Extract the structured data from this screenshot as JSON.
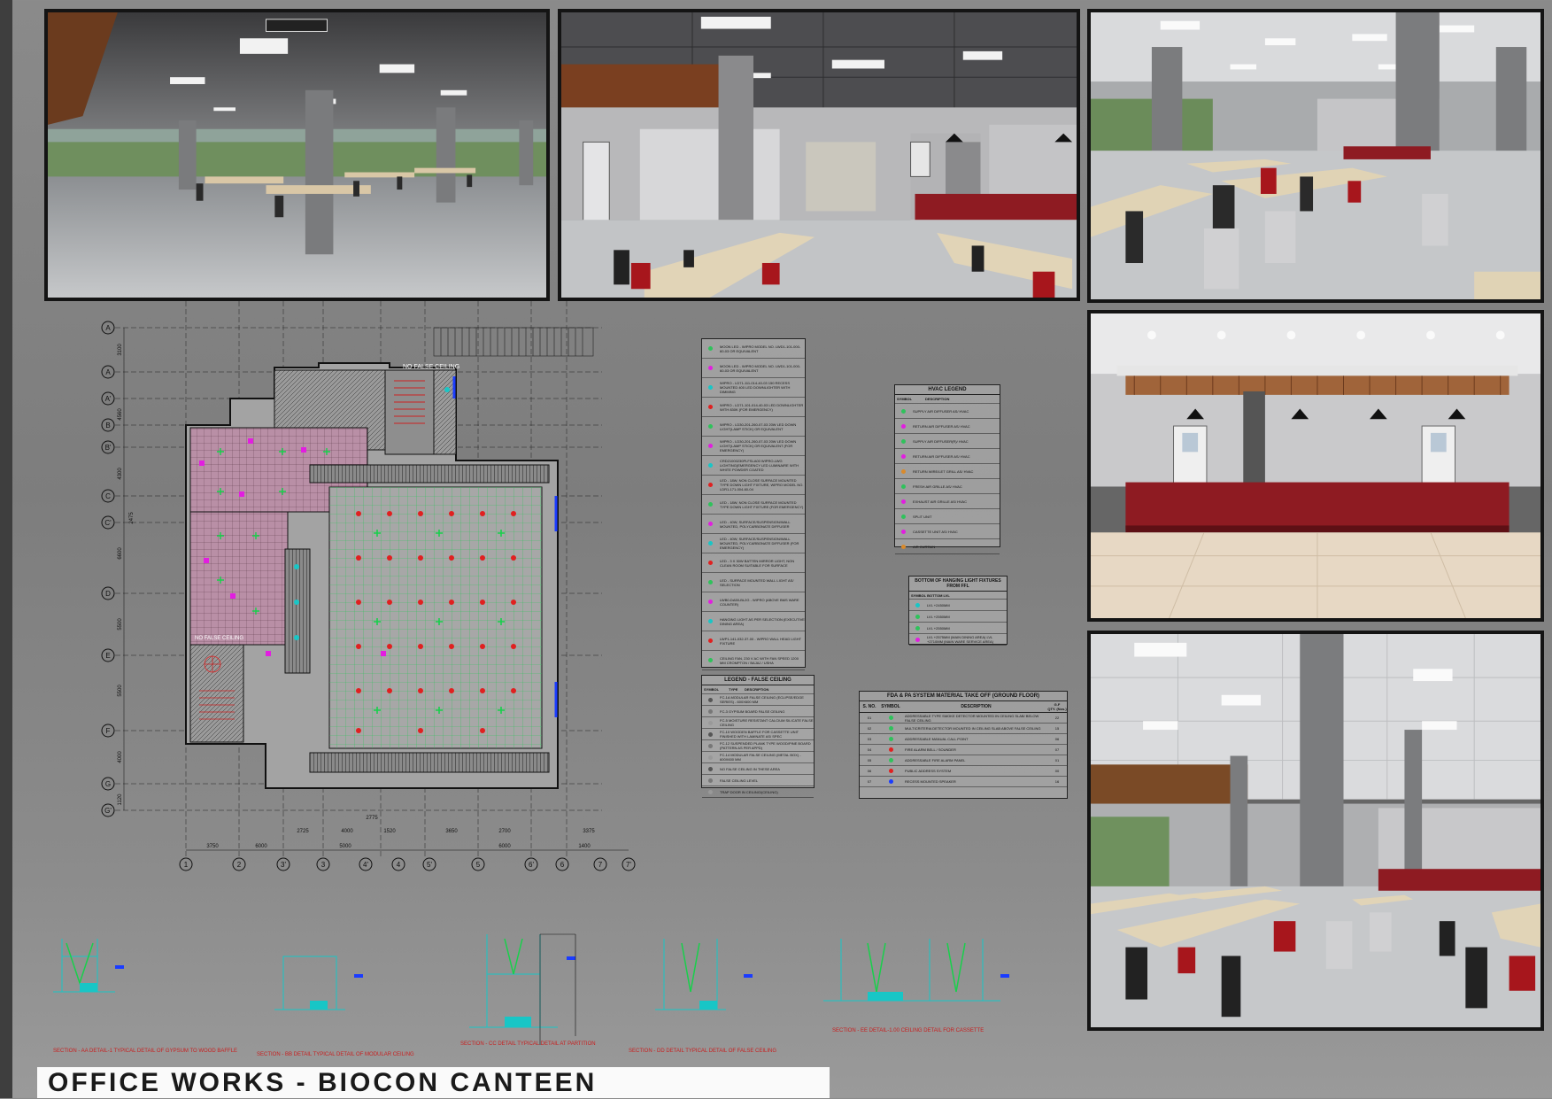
{
  "title": "OFFICE WORKS - BIOCON CANTEEN",
  "renders": [
    {
      "name": "render-dining-hall-wide"
    },
    {
      "name": "render-dining-to-servery"
    },
    {
      "name": "render-dining-tables"
    },
    {
      "name": "render-service-counter"
    },
    {
      "name": "render-dining-columns"
    }
  ],
  "plan": {
    "grid_rows": [
      "A",
      "A",
      "A'",
      "B",
      "B'",
      "C",
      "C'",
      "D",
      "E",
      "F",
      "G",
      "G'"
    ],
    "grid_cols": [
      "1",
      "2",
      "3'",
      "3",
      "4'",
      "4",
      "5'",
      "5",
      "6'",
      "6",
      "7",
      "7'"
    ],
    "dims_bottom": [
      "3750",
      "6000",
      "2725",
      "4000",
      "5000",
      "1520",
      "3650",
      "2700",
      "6000",
      "1400",
      "3375",
      "2775"
    ],
    "dims_left": [
      "3100",
      "4560",
      "4300",
      "2475",
      "6600",
      "5500",
      "5500",
      "4000",
      "1120"
    ],
    "labels": [
      "NO FALSE CEILING",
      "NO FALSE CEILING"
    ]
  },
  "lighting_legend": {
    "items": [
      "MOON LED - WIPRO MODEL NO. LWD1-101-000-60-03 OR EQUIVALENT",
      "MOON LED - WIPRO MODEL NO. LWD1-101-000-60-03 OR EQUIVALENT",
      "WIPRO - LD71-111-014-40-03 150 RECESS MOUNTED 400 LED DOWNLIGHTER WITH DIMMING",
      "WIPRO - LD71-101-014-40-03 LED DOWNLIGHTER WITH 830K (FOR EMERGENCY)",
      "WIPRO - LD30-201-260-07-03 20W LED DOWN LIGHT(LAMP STICK) OR EQUIVALENT",
      "WIPRO - LD30-201-260-07-03 20W LED DOWN LIGHT(LAMP STICK) OR EQUIVALENT (FOR EMERGENCY)",
      "CRD21000230PLFSLA00 WIPRO-LWG LIGHTING(EMERGENCY LED LUMINAIRE WITH WHITE POWDER COATED",
      "LED - 18W, NON CLOSE SURFACE MOUNTED TYPE DOWN LIGHT FIXTURE, WIPRO MODEL NO. LDR1-171-004-60-04",
      "LED - 18W, NON CLOSE SURFACE MOUNTED TYPE DOWN LIGHT FIXTURE (FOR EMERGENCY)",
      "LED - 40W, SURFACE/SUSPENSION/WALL MOUNTED, POLYCARBONATE DIFFUSER",
      "LED - 40W, SURFACE/SUSPENSION/WALL MOUNTED, POLYCARBONATE DIFFUSER (FOR EMERGENCY)",
      "LED - 3 X 30W BATTEN MIRROR LIGHT, NON CLEAN ROOM SUITABLE FOR SURFACE",
      "LED - SURFACE MOUNTED WALL LIGHT AS/ SELECTION",
      "LWB0-DA50-BL2G - WIPRO (ABOVE BMS WARE COUNTER)",
      "HANGING LIGHT AS PER SELECTION (EXECUTIVE DINING AREA)",
      "LWP1-141-032-37-00 - WIPRO WALL HEAD LIGHT FIXTURE",
      "CEILING FAN, 230 V AC WITH FAN SPEED 1200 MM CROMPTON / BAJAJ / USHA"
    ]
  },
  "false_ceiling_legend": {
    "title": "LEGEND - FALSE CEILING",
    "header": [
      "SYMBOL",
      "TYPE",
      "DESCRIPTION"
    ],
    "items": [
      "FC-1A MODULAR FALSE CEILING (ECLIPSE/EDGE SERIES) - 600X600 MM",
      "FC-3 GYPSUM BOARD FALSE CEILING",
      "FC-5 MOISTURE RESISTANT CALCIUM SILICATE FALSE CEILING",
      "FC-10 WOODEN BAFFLE FOR CASSETTE UNIT FINISHED WITH LAMINATE AS/ SPEC",
      "FC-12 SUSPENDED PLANK TYPE WOOD/PINE BOARD (PATTERN AS PER APPD)",
      "FC-14 MODULAR FALSE CEILING (METAL BOX) - 600X600 MM",
      "NO FALSE CEILING IN THESE AREA",
      "FALSE CEILING LEVEL",
      "TRAP DOOR IN CEILING/(CEILING)"
    ]
  },
  "hvac_legend": {
    "title": "HVAC LEGEND",
    "header": [
      "SYMBOL",
      "DESCRIPTION"
    ],
    "items": [
      "SUPPLY AIR DIFFUSER AS/ HVAC",
      "RETURN AIR DIFFUSER AS/ HVAC",
      "SUPPLY AIR DIFFUSER(R)/ HVAC",
      "RETURN AIR DIFFUSER AS/ HVAC",
      "RETURN WIRE/LET GRILL AS/ HVAC",
      "FRESH AIR GRILLE AS/ HVAC",
      "EXHAUST AIR GRILLE AS/ HVAC",
      "SPLIT UNIT",
      "CASSETTE UNIT AS/ HVAC",
      "AIR CURTAIN"
    ]
  },
  "hanging_legend": {
    "title": "BOTTOM OF HANGING LIGHT FIXTURES FROM FFL",
    "header": "SYMBOL BOTTOM LVL",
    "items": [
      "LVL +2450MM",
      "LVL +2550MM",
      "LVL +2550MM",
      "LVL +2575MM (MAIN DINING AREA) LVL +2710MM (MAIN WARE SERVICE AREA)"
    ]
  },
  "fda_table": {
    "title": "FDA & PA SYSTEM MATERIAL TAKE OFF (GROUND FLOOR)",
    "header": [
      "S. NO.",
      "SYMBOL",
      "DESCRIPTION",
      "QTY. (Nos.)"
    ],
    "header_extra": "G.F",
    "rows": [
      {
        "no": "01",
        "desc": "ADDRESSABLE TYPE SMOKE DETECTOR MOUNTED IN CEILING SLAB/ BELOW FALSE CEILING",
        "qty": "22"
      },
      {
        "no": "02",
        "desc": "MULTICRITERIA DETECTOR MOUNTED IN CEILING SLAB ABOVE FALSE CEILING",
        "qty": "15"
      },
      {
        "no": "03",
        "desc": "ADDRESSABLE MANUAL CALL POINT",
        "qty": "06"
      },
      {
        "no": "04",
        "desc": "FIRE ALARM BELL / SOUNDER",
        "qty": "07"
      },
      {
        "no": "05",
        "desc": "ADDRESSABLE FIRE ALARM PANEL",
        "qty": "01"
      },
      {
        "no": "06",
        "desc": "PUBLIC ADDRESS SYSTEM",
        "qty": "00"
      },
      {
        "no": "07",
        "desc": "RECESS MOUNTED SPEAKER",
        "qty": "16"
      }
    ]
  },
  "sections": {
    "detail_titles": [
      "SECTION - AA DETAIL-1 TYPICAL DETAIL OF GYPSUM TO WOOD BAFFLE",
      "SECTION - BB DETAIL TYPICAL DETAIL OF MODULAR CEILING",
      "SECTION - CC DETAIL TYPICAL DETAIL AT PARTITION",
      "SECTION - DD DETAIL TYPICAL DETAIL OF FALSE CEILING",
      "SECTION - EE DETAIL-1.00 CEILING DETAIL FOR CASSETTE"
    ]
  },
  "colors": {
    "cad_green": "#2fc25b",
    "cad_magenta": "#e21ee0",
    "cad_red": "#e02020",
    "cad_cyan": "#18c6c6",
    "counter_red": "#8e1b22",
    "frame": "#141414"
  }
}
